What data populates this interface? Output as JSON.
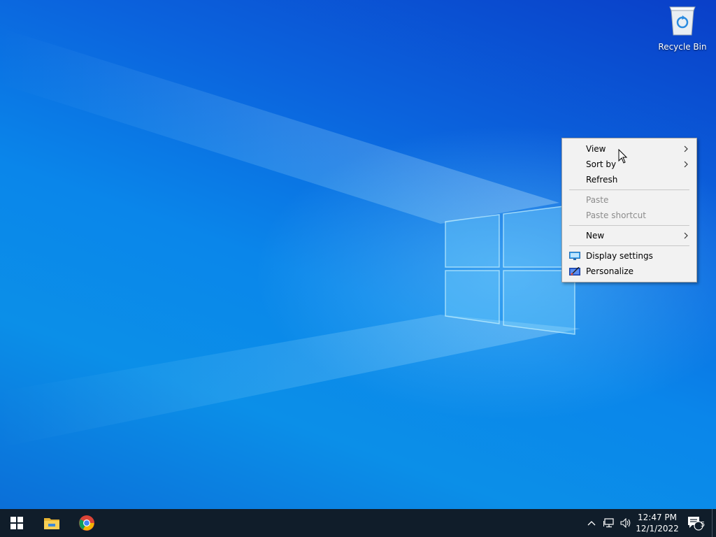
{
  "desktop": {
    "recycle_bin_label": "Recycle Bin"
  },
  "context_menu": {
    "items": [
      {
        "label": "View",
        "submenu": true,
        "enabled": true
      },
      {
        "label": "Sort by",
        "submenu": true,
        "enabled": true
      },
      {
        "label": "Refresh",
        "submenu": false,
        "enabled": true
      },
      {
        "label": "Paste",
        "submenu": false,
        "enabled": false
      },
      {
        "label": "Paste shortcut",
        "submenu": false,
        "enabled": false
      },
      {
        "label": "New",
        "submenu": true,
        "enabled": true
      },
      {
        "label": "Display settings",
        "submenu": false,
        "enabled": true,
        "icon": "display-icon"
      },
      {
        "label": "Personalize",
        "submenu": false,
        "enabled": true,
        "icon": "personalize-icon"
      }
    ]
  },
  "taskbar": {
    "start_icon": "windows-logo-icon",
    "pinned": [
      "file-explorer-icon",
      "chrome-icon"
    ],
    "tray": {
      "time": "12:47 PM",
      "date": "12/1/2022",
      "notification_count": "5"
    }
  },
  "colors": {
    "taskbar": "#101d2a",
    "menu_bg": "#f2f2f2",
    "disabled_text": "#8c8c8c"
  }
}
